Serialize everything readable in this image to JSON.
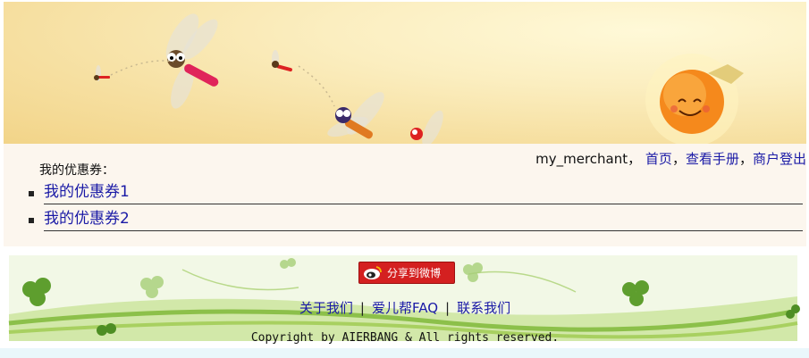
{
  "header": {
    "banner_icon": "dragonflies-sun-banner"
  },
  "user_nav": {
    "username": "my_merchant",
    "separator": "，",
    "home_label": "首页",
    "manual_label": "查看手册",
    "logout_label": "商户登出",
    "comma": "，"
  },
  "coupons": {
    "section_label": "我的优惠券：",
    "items": [
      {
        "label": "我的优惠券1"
      },
      {
        "label": "我的优惠券2"
      }
    ]
  },
  "footer": {
    "share_label": "分享到微博",
    "share_icon": "weibo-icon",
    "links": [
      {
        "label": "关于我们"
      },
      {
        "label": "爱儿帮FAQ"
      },
      {
        "label": "联系我们"
      }
    ],
    "link_separator": "|",
    "copyright": "Copyright by AIERBANG & All rights reserved.",
    "decoration": "clover-vine-decoration"
  },
  "colors": {
    "link": "#1a1aa6",
    "banner_bg": "#f6dfa0",
    "content_bg": "#fcf6ee",
    "share_button": "#d42020"
  }
}
